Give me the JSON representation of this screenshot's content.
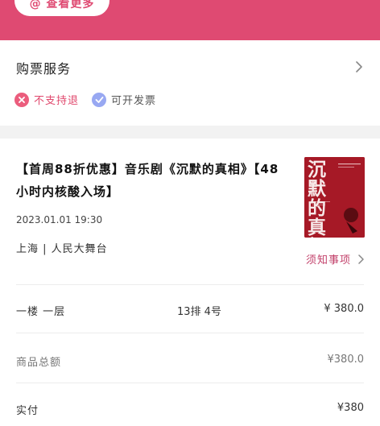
{
  "top": {
    "pill_text": "@ 查看更多"
  },
  "service": {
    "title": "购票服务",
    "tags": [
      {
        "label": "不支持退",
        "icon": "close-circle-icon"
      },
      {
        "label": "可开发票",
        "icon": "check-circle-icon"
      }
    ]
  },
  "order": {
    "title": "【首周88折优惠】音乐剧《沉默的真相》【48小时内核酸入场】",
    "date": "2023.01.01 19:30",
    "venue": "上海 | 人民大舞台",
    "notice": "须知事项",
    "poster_text": "沉默的真相",
    "seat": {
      "area": "一楼 一层",
      "seat": "13排 4号",
      "price": "¥ 380.0"
    },
    "total": {
      "label": "商品总额",
      "value": "¥380.0"
    },
    "paid": {
      "label": "实付",
      "value": "¥380"
    }
  },
  "colors": {
    "brand": "#df4a72",
    "accent_blue": "#98a8f2"
  }
}
